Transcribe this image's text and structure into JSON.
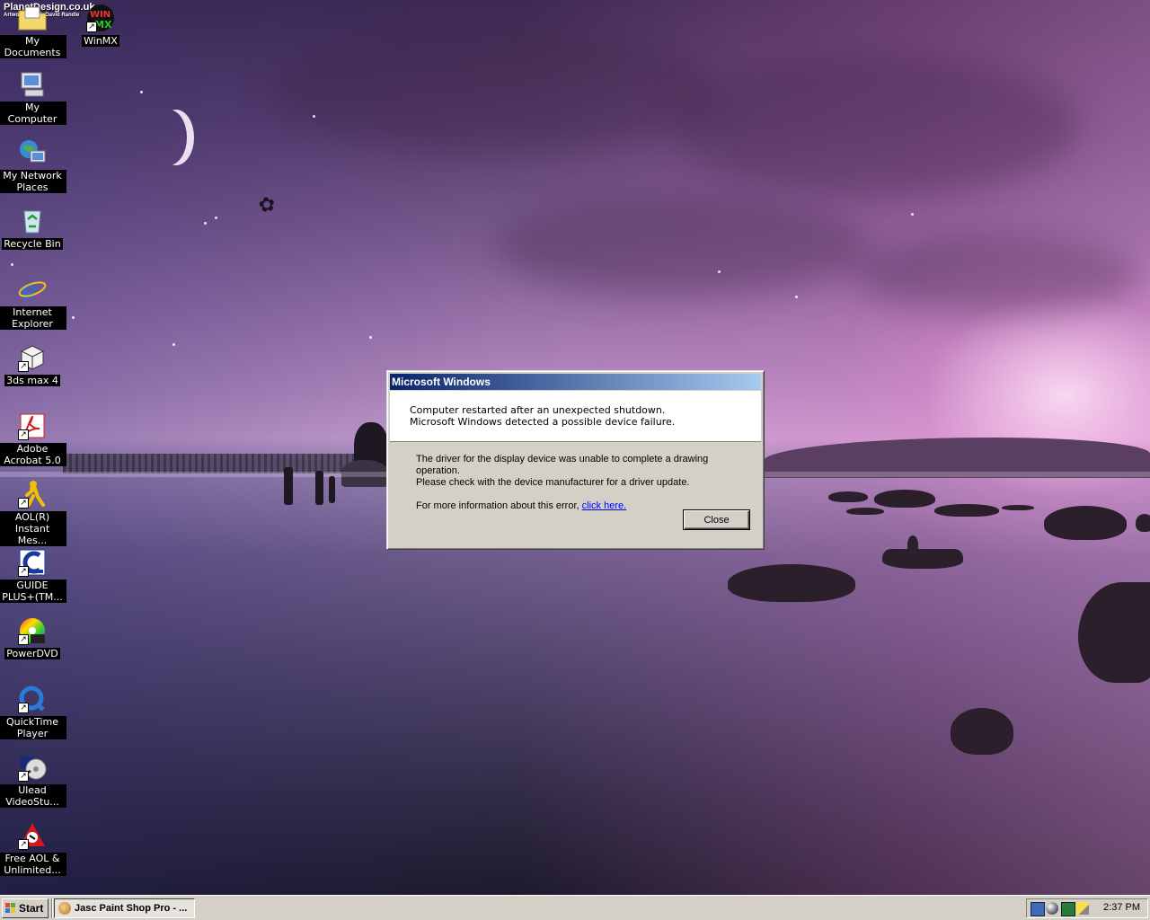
{
  "wallpaper": {
    "logo_line1": "PlanetDesign.co.uk",
    "logo_line2": "Artwork by Rob David Randle"
  },
  "desktop_icons": [
    {
      "label": "My Documents",
      "icon": "folder-icon"
    },
    {
      "label": "WinMX",
      "icon": "winmx-icon"
    },
    {
      "label": "My Computer",
      "icon": "computer-icon"
    },
    {
      "label": "My Network Places",
      "icon": "network-icon"
    },
    {
      "label": "Recycle Bin",
      "icon": "recycle-bin-icon"
    },
    {
      "label": "Internet Explorer",
      "icon": "internet-explorer-icon"
    },
    {
      "label": "3ds max 4",
      "icon": "3ds-max-icon"
    },
    {
      "label": "Adobe Acrobat 5.0",
      "icon": "acrobat-icon"
    },
    {
      "label": "AOL(R) Instant Mes...",
      "icon": "aim-icon"
    },
    {
      "label": "GUIDE PLUS+(TM...",
      "icon": "guide-plus-icon"
    },
    {
      "label": "PowerDVD",
      "icon": "powerdvd-icon"
    },
    {
      "label": "QuickTime Player",
      "icon": "quicktime-icon"
    },
    {
      "label": "Ulead VideoStu...",
      "icon": "ulead-icon"
    },
    {
      "label": "Free AOL & Unlimited...",
      "icon": "aol-icon"
    }
  ],
  "dialog": {
    "title": "Microsoft Windows",
    "header_line1": "Computer restarted after an unexpected shutdown.",
    "header_line2": "Microsoft Windows detected a possible device failure.",
    "body_line1": "The driver for the display device was unable to complete a drawing operation.",
    "body_line2": "Please check with the device manufacturer for a driver update.",
    "more_info_prefix": "For more information about this error,",
    "link_text": "click here.",
    "close_label": "Close"
  },
  "taskbar": {
    "start_label": "Start",
    "tasks": [
      {
        "label": "Jasc Paint Shop Pro - ...",
        "icon": "paint-shop-pro-icon"
      }
    ],
    "clock": "2:37 PM",
    "tray_icons": [
      "network-tray-icon",
      "globe-tray-icon",
      "nc-tray-icon",
      "pencil-tray-icon"
    ]
  }
}
